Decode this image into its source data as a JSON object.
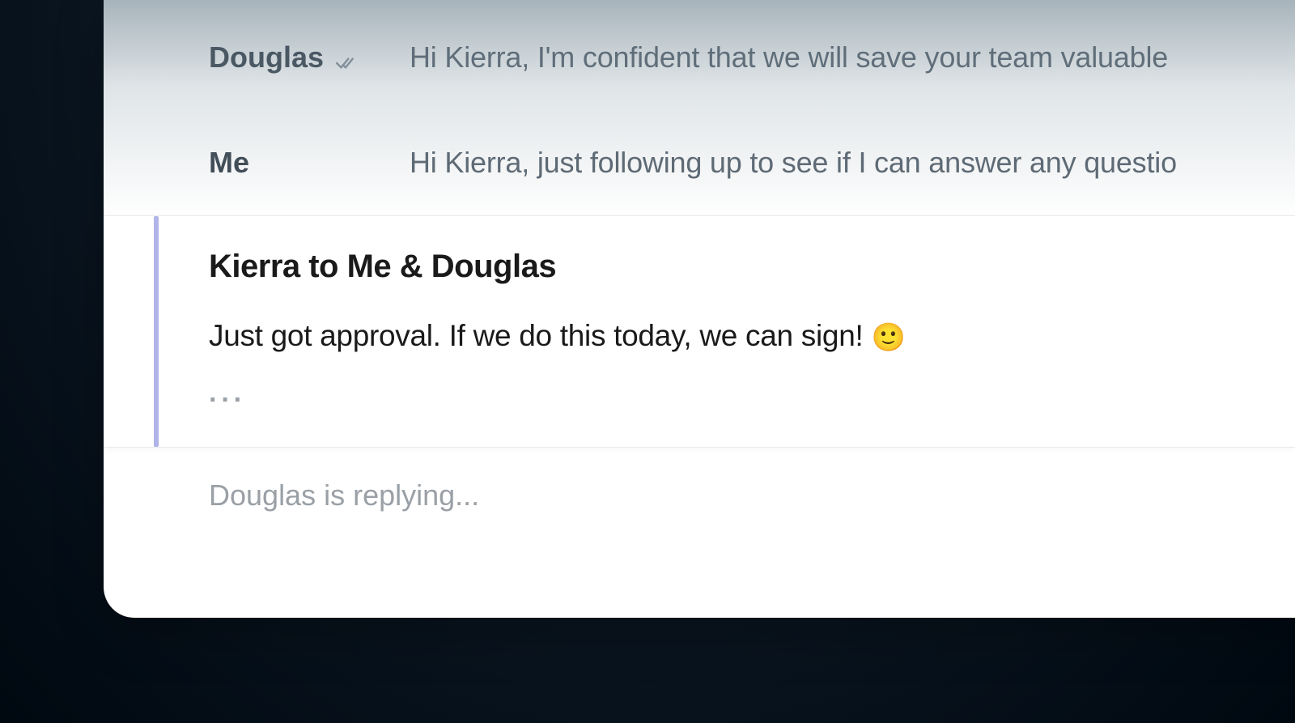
{
  "messages": [
    {
      "sender": "Douglas",
      "has_check": true,
      "preview": "Hi Kierra, I'm confident that we will save your team valuable"
    },
    {
      "sender": "Me",
      "has_check": false,
      "preview": "Hi Kierra, just following up to see if I can answer any questio"
    }
  ],
  "selected_message": {
    "header": "Kierra to Me & Douglas",
    "body": "Just got approval. If we do this today, we can sign! ",
    "emoji": "🙂",
    "ellipsis": "···"
  },
  "typing_status": "Douglas is replying..."
}
